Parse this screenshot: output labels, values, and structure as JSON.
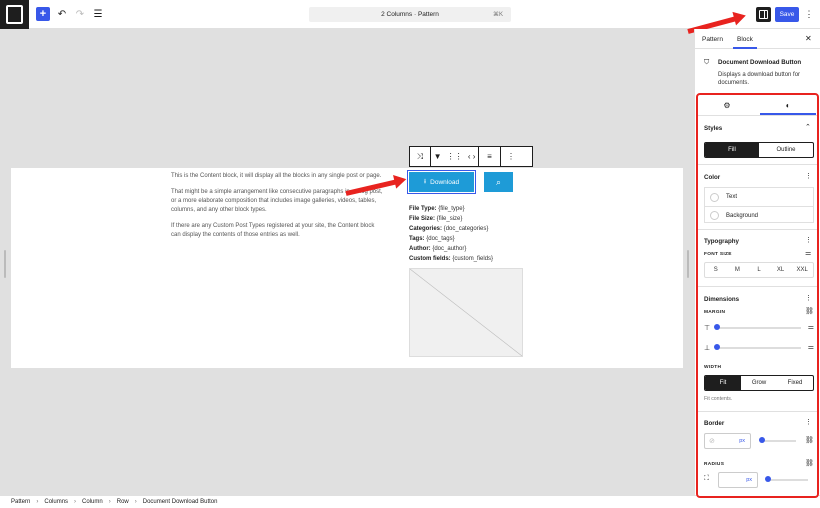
{
  "topbar": {
    "add_icon": "plus-icon",
    "undo_icon": "undo-icon",
    "redo_icon": "redo-icon",
    "list_view_icon": "list-view-icon",
    "document_title": "2 Columns · Pattern",
    "shortcut": "⌘K",
    "settings_icon": "sidebar-toggle-icon",
    "save_label": "Save",
    "more_icon": "more-vertical-icon"
  },
  "content": {
    "paragraphs": [
      "This is the Content block, it will display all the blocks in any single post or page.",
      "That might be a simple arrangement like consecutive paragraphs in a blog post, or a more elaborate composition that includes image galleries, videos, tables, columns, and any other block types.",
      "If there are any Custom Post Types registered at your site, the Content block can display the contents of those entries as well."
    ],
    "download_label": "Download",
    "meta": [
      {
        "label": "File Type:",
        "value": "{file_type}"
      },
      {
        "label": "File Size:",
        "value": "{file_size}"
      },
      {
        "label": "Categories:",
        "value": "{doc_categories}"
      },
      {
        "label": "Tags:",
        "value": "{doc_tags}"
      },
      {
        "label": "Author:",
        "value": "{doc_author}"
      },
      {
        "label": "Custom fields:",
        "value": "{custom_fields}"
      }
    ]
  },
  "breadcrumb": [
    "Pattern",
    "Columns",
    "Column",
    "Row",
    "Document Download Button"
  ],
  "sidebar": {
    "tabs": [
      "Pattern",
      "Block"
    ],
    "active_tab": "Block",
    "block_name": "Document Download Button",
    "block_description": "Displays a download button for documents.",
    "styles": {
      "title": "Styles",
      "options": [
        "Fill",
        "Outline"
      ],
      "selected": "Fill"
    },
    "color": {
      "title": "Color",
      "items": [
        "Text",
        "Background"
      ]
    },
    "typography": {
      "title": "Typography",
      "font_size_label": "FONT SIZE",
      "sizes": [
        "S",
        "M",
        "L",
        "XL",
        "XXL"
      ]
    },
    "dimensions": {
      "title": "Dimensions",
      "margin_label": "MARGIN",
      "width_label": "WIDTH",
      "width_options": [
        "Fit",
        "Grow",
        "Fixed"
      ],
      "width_selected": "Fit",
      "help": "Fit contents."
    },
    "border": {
      "title": "Border",
      "unit": "px",
      "radius_label": "RADIUS",
      "radius_unit": "px"
    }
  },
  "colors": {
    "accent": "#3858e9",
    "button": "#1e9bd7",
    "annotation": "#e8231f"
  }
}
